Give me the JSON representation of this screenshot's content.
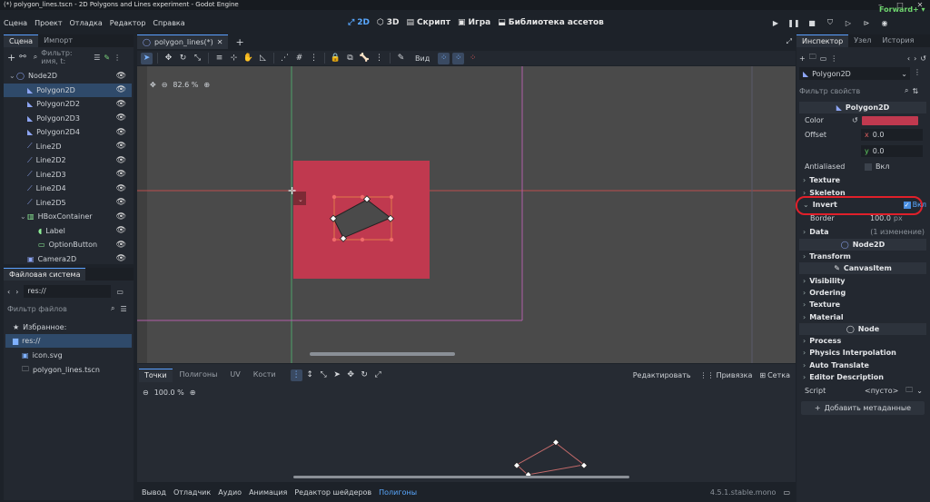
{
  "window": {
    "title": "(*) polygon_lines.tscn - 2D Polygons and Lines experiment - Godot Engine"
  },
  "menu": [
    "Сцена",
    "Проект",
    "Отладка",
    "Редактор",
    "Справка"
  ],
  "workspaces": [
    {
      "label": "2D",
      "icon": "2d-icon"
    },
    {
      "label": "3D",
      "icon": "3d-icon"
    },
    {
      "label": "Скрипт",
      "icon": "script-icon"
    },
    {
      "label": "Игра",
      "icon": "game-icon"
    },
    {
      "label": "Библиотека ассетов",
      "icon": "asset-lib-icon"
    }
  ],
  "renderer": "Forward+",
  "scene_dock": {
    "tabs": [
      "Сцена",
      "Импорт"
    ],
    "filter_placeholder": "Фильтр: имя, t:",
    "nodes": [
      {
        "label": "Node2D",
        "icon": "node2d-icon",
        "color": "#8da5f3"
      },
      {
        "label": "Polygon2D",
        "icon": "polygon2d-icon",
        "color": "#8da5f3"
      },
      {
        "label": "Polygon2D2",
        "icon": "polygon2d-icon",
        "color": "#8da5f3"
      },
      {
        "label": "Polygon2D3",
        "icon": "polygon2d-icon",
        "color": "#8da5f3"
      },
      {
        "label": "Polygon2D4",
        "icon": "polygon2d-icon",
        "color": "#8da5f3"
      },
      {
        "label": "Line2D",
        "icon": "line2d-icon",
        "color": "#8da5f3"
      },
      {
        "label": "Line2D2",
        "icon": "line2d-icon",
        "color": "#8da5f3"
      },
      {
        "label": "Line2D3",
        "icon": "line2d-icon",
        "color": "#8da5f3"
      },
      {
        "label": "Line2D4",
        "icon": "line2d-icon",
        "color": "#8da5f3"
      },
      {
        "label": "Line2D5",
        "icon": "line2d-icon",
        "color": "#8da5f3"
      },
      {
        "label": "HBoxContainer",
        "icon": "hbox-icon",
        "color": "#8eef97"
      },
      {
        "label": "Label",
        "icon": "label-icon",
        "color": "#8eef97"
      },
      {
        "label": "OptionButton",
        "icon": "optionbutton-icon",
        "color": "#8eef97"
      },
      {
        "label": "Camera2D",
        "icon": "camera2d-icon",
        "color": "#8da5f3"
      }
    ]
  },
  "filesystem": {
    "tab": "Файловая система",
    "path": "res://",
    "filter_placeholder": "Фильтр файлов",
    "favorites": "Избранное:",
    "root": "res://",
    "files": [
      "icon.svg",
      "polygon_lines.tscn"
    ]
  },
  "editor": {
    "scene_tab": "polygon_lines(*)",
    "view_menu": "Вид",
    "zoom": "82.6 %"
  },
  "polygon_editor": {
    "tabs": [
      "Точки",
      "Полигоны",
      "UV",
      "Кости"
    ],
    "edit": "Редактировать",
    "snap": "Привязка",
    "grid": "Сетка",
    "zoom": "100.0 %"
  },
  "bottom_panel": {
    "tabs": [
      "Вывод",
      "Отладчик",
      "Аудио",
      "Анимация",
      "Редактор шейдеров",
      "Полигоны"
    ],
    "version": "4.5.1.stable.mono"
  },
  "inspector": {
    "tabs": [
      "Инспектор",
      "Узел",
      "История"
    ],
    "node": "Polygon2D",
    "filter_placeholder": "Фильтр свойств",
    "class_header": "Polygon2D",
    "color_label": "Color",
    "color_value": "#c0394f",
    "offset_label": "Offset",
    "offset_x": "0.0",
    "offset_y": "0.0",
    "antialiased_label": "Antialiased",
    "antialiased_value": "Вкл",
    "texture": "Texture",
    "skeleton": "Skeleton",
    "invert": "Invert",
    "invert_value": "Вкл",
    "border_label": "Border",
    "border_value": "100.0",
    "border_unit": "px",
    "data": "Data",
    "data_note": "(1 изменение)",
    "node2d_header": "Node2D",
    "transform": "Transform",
    "canvasitem_header": "CanvasItem",
    "visibility": "Visibility",
    "ordering": "Ordering",
    "texture2": "Texture",
    "material": "Material",
    "node_header": "Node",
    "process": "Process",
    "physics": "Physics Interpolation",
    "auto_translate": "Auto Translate",
    "editor_desc": "Editor Description",
    "script_label": "Script",
    "script_value": "<пусто>",
    "add_meta": "Добавить метаданные"
  }
}
